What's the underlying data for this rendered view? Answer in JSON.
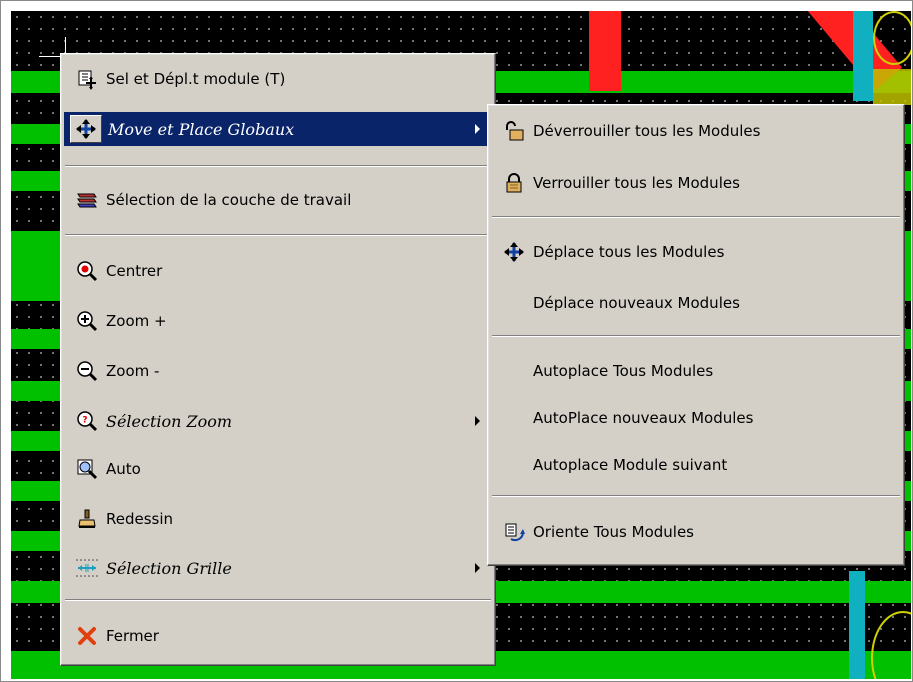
{
  "main_menu": {
    "items": [
      {
        "label": "Sel et Dépl.t module (T)",
        "icon": "move-module-icon"
      },
      {
        "label": "Move et Place Globaux",
        "icon": "move-cross-icon",
        "submenu": true,
        "highlighted": true
      },
      {
        "label": "Sélection de la couche de travail",
        "icon": "layer-stack-icon"
      },
      {
        "label": "Centrer",
        "icon": "zoom-center-icon"
      },
      {
        "label": "Zoom +",
        "icon": "zoom-in-icon"
      },
      {
        "label": "Zoom -",
        "icon": "zoom-out-icon"
      },
      {
        "label": "Sélection Zoom",
        "icon": "zoom-select-icon",
        "submenu": true
      },
      {
        "label": "Auto",
        "icon": "zoom-auto-icon"
      },
      {
        "label": "Redessin",
        "icon": "redraw-brush-icon"
      },
      {
        "label": "Sélection Grille",
        "icon": "grid-select-icon",
        "submenu": true
      },
      {
        "label": "Fermer",
        "icon": "close-x-icon"
      }
    ]
  },
  "sub_menu": {
    "items": [
      {
        "label": "Déverrouiller tous les Modules",
        "icon": "unlock-icon"
      },
      {
        "label": "Verrouiller tous les Modules",
        "icon": "lock-icon"
      },
      {
        "label": "Déplace tous les Modules",
        "icon": "move-cross-icon"
      },
      {
        "label": "Déplace nouveaux Modules"
      },
      {
        "label": "Autoplace Tous Modules"
      },
      {
        "label": "AutoPlace nouveaux Modules"
      },
      {
        "label": "Autoplace Module suivant"
      },
      {
        "label": "Oriente Tous Modules",
        "icon": "rotate-modules-icon"
      }
    ]
  },
  "colors": {
    "menu_bg": "#d4d0c8",
    "highlight": "#0a246a",
    "board_green": "#00c000",
    "track_red": "#ff2020",
    "track_cyan": "#10b0c0"
  }
}
